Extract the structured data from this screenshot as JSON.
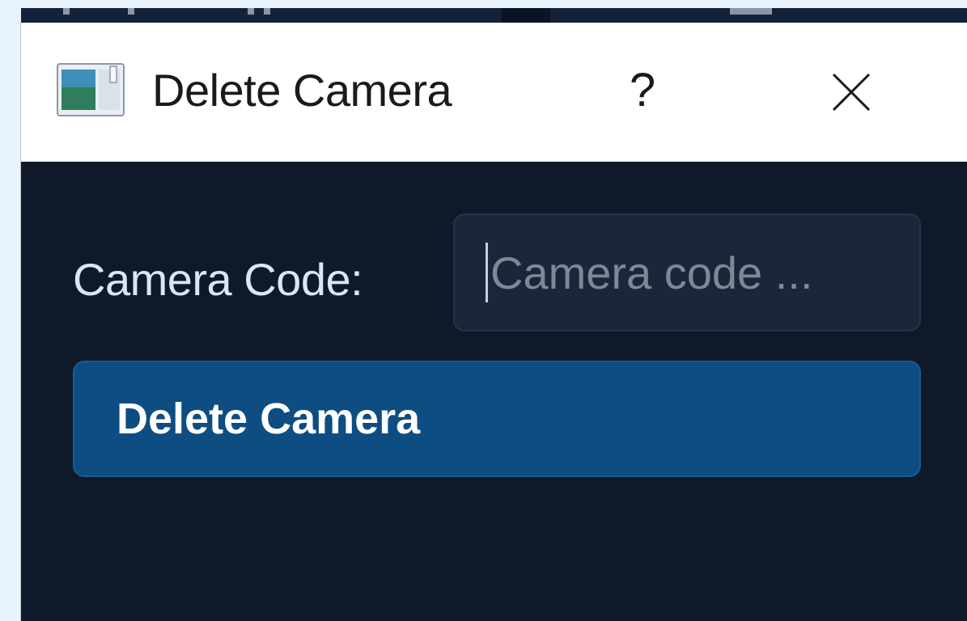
{
  "window": {
    "title": "Delete Camera",
    "app_icon": "window-app-icon",
    "help_label": "?",
    "close_icon": "close-icon"
  },
  "form": {
    "camera_code_label": "Camera Code:",
    "camera_code_value": "",
    "camera_code_placeholder": "Camera code ...",
    "delete_button_label": "Delete Camera"
  },
  "colors": {
    "titlebar_bg": "#ffffff",
    "dialog_bg": "#0f1929",
    "input_bg": "#1c2639",
    "button_bg": "#0e4d82",
    "label_text": "#dce6f2",
    "placeholder_text": "#7d8898"
  }
}
